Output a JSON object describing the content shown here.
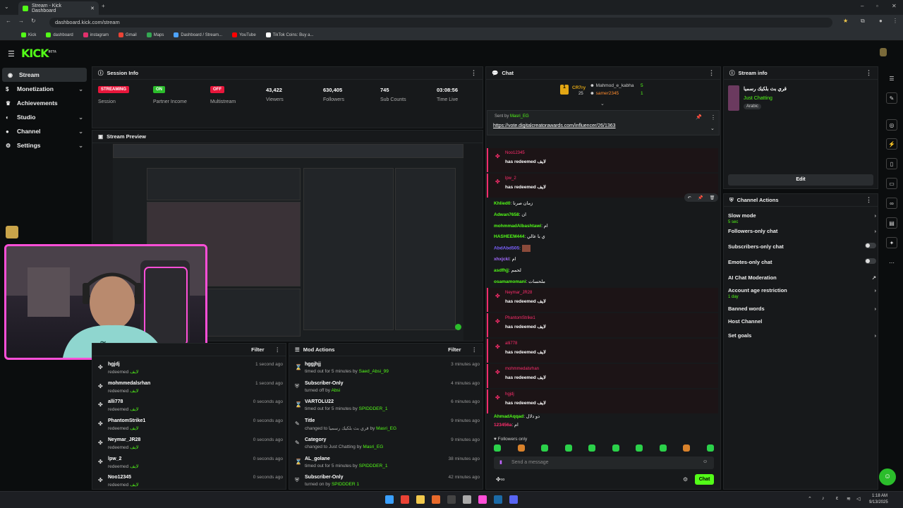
{
  "browser": {
    "tab_title": "Stream - Kick Dashboard",
    "url": "dashboard.kick.com/stream",
    "bookmarks": [
      "Kick",
      "dashboard",
      "instagram",
      "Gmail",
      "Maps",
      "Dashboard / Stream...",
      "YouTube",
      "TikTok Coins: Buy a..."
    ]
  },
  "app": {
    "logo": "KICK",
    "logo_tag": "BETA"
  },
  "nav": {
    "items": [
      {
        "label": "Stream",
        "icon": "broadcast-icon",
        "expandable": false
      },
      {
        "label": "Monetization",
        "icon": "dollar-icon",
        "expandable": true
      },
      {
        "label": "Achievements",
        "icon": "trophy-icon",
        "expandable": false
      },
      {
        "label": "Studio",
        "icon": "studio-icon",
        "expandable": true
      },
      {
        "label": "Channel",
        "icon": "person-icon",
        "expandable": true
      },
      {
        "label": "Settings",
        "icon": "gear-icon",
        "expandable": true
      }
    ]
  },
  "session": {
    "title": "Session Info",
    "items": [
      {
        "badge": "STREAMING",
        "badge_color": "#e8163b",
        "label": "Session"
      },
      {
        "badge": "ON",
        "badge_color": "#2bbd2b",
        "label": "Partner Income"
      },
      {
        "badge": "OFF",
        "badge_color": "#e8163b",
        "label": "Multistream"
      },
      {
        "value": "43,422",
        "label": "Viewers"
      },
      {
        "value": "630,405",
        "label": "Followers"
      },
      {
        "value": "745",
        "label": "Sub Counts"
      },
      {
        "value": "03:08:56",
        "label": "Time Live"
      }
    ]
  },
  "preview": {
    "title": "Stream Preview"
  },
  "redemptions": {
    "filter": "Filter",
    "rows": [
      {
        "user": "hgjdj",
        "action": "redeemed",
        "reward": "لايف",
        "time": "1 second ago"
      },
      {
        "user": "mohmmedalsrhan",
        "action": "redeemed",
        "reward": "لايف",
        "time": "1 second ago"
      },
      {
        "user": "alli778",
        "action": "redeemed",
        "reward": "لايف",
        "time": "0 seconds ago"
      },
      {
        "user": "PhantomStrike1",
        "action": "redeemed",
        "reward": "لايف",
        "time": "0 seconds ago"
      },
      {
        "user": "Neymar_JR28",
        "action": "redeemed",
        "reward": "لايف",
        "time": "0 seconds ago"
      },
      {
        "user": "lpw_2",
        "action": "redeemed",
        "reward": "لايف",
        "time": "0 seconds ago"
      },
      {
        "user": "Noo12345",
        "action": "redeemed",
        "reward": "لايف",
        "time": "0 seconds ago"
      }
    ]
  },
  "mod_actions": {
    "title": "Mod Actions",
    "filter": "Filter",
    "rows": [
      {
        "icon": "timeout-icon",
        "name": "hggjhjj",
        "detail": "timed out for 5 minutes by",
        "by": "Saed_Absi_99",
        "time": "3 minutes ago"
      },
      {
        "icon": "shield-icon",
        "name": "Subscriber-Only",
        "detail": "turned off by",
        "by": "Absi",
        "time": "4 minutes ago"
      },
      {
        "icon": "timeout-icon",
        "name": "VARTOLU22",
        "detail": "timed out for 5 minutes by",
        "by": "SPIDDDER_1",
        "time": "6 minutes ago"
      },
      {
        "icon": "edit-icon",
        "name": "Title",
        "detail": "changed to قري بث بلكيك رسميا by",
        "by": "Masri_EG",
        "time": "9 minutes ago"
      },
      {
        "icon": "edit-icon",
        "name": "Category",
        "detail": "changed to Just Chatting by",
        "by": "Masri_EG",
        "time": "9 minutes ago"
      },
      {
        "icon": "timeout-icon",
        "name": "AL_golane",
        "detail": "timed out for 5 minutes by",
        "by": "SPIDDDER_1",
        "time": "38 minutes ago"
      },
      {
        "icon": "shield-icon",
        "name": "Subscriber-Only",
        "detail": "turned on by",
        "by": "SPIDDDER 1",
        "time": "42 minutes ago"
      }
    ]
  },
  "chat": {
    "title": "Chat",
    "top_gifter": {
      "name": "CR7ry",
      "count": "25"
    },
    "top_users": [
      {
        "name": "Mahmod_e_kabha",
        "count": "5"
      },
      {
        "name": "samer2345",
        "count": "1"
      }
    ],
    "pinned": {
      "sent_by": "Sent by",
      "by_user": "Masri_EG",
      "link": "https://vote.digitalcreatorawards.com/influencer/26/1363"
    },
    "redeem_text": "has redeemed",
    "reward": "لايف",
    "redeems_top": [
      {
        "user": "Noo12345"
      },
      {
        "user": "lpw_2"
      }
    ],
    "messages": [
      {
        "user": "Khlied0",
        "color": "#53fc18",
        "text": "زمان صرنا"
      },
      {
        "user": "Adwan7658",
        "color": "#53fc18",
        "text": "ان"
      },
      {
        "user": "mohmmadAlbashtawi",
        "color": "#53fc18",
        "text": "ام"
      },
      {
        "user": "HASHEEM444",
        "color": "#53fc18",
        "text": "ي با عالي"
      },
      {
        "user": "AbdAbd505",
        "color": "#7b61ff",
        "text": ""
      },
      {
        "user": "xhxjckl",
        "color": "#a46bff",
        "text": "ام"
      },
      {
        "user": "asdfhjj",
        "color": "#53fc18",
        "text": "لحمم"
      },
      {
        "user": "osamamomani",
        "color": "#53fc18",
        "text": "ملحسات"
      }
    ],
    "redeems_bottom": [
      {
        "user": "Neymar_JR28"
      },
      {
        "user": "PhantomStrike1"
      },
      {
        "user": "alli778"
      },
      {
        "user": "mohmmedalsrhan"
      },
      {
        "user": "hgjdj"
      }
    ],
    "tail_messages": [
      {
        "user": "AhmadAqqad",
        "color": "#53fc18",
        "text": "دو دلال"
      },
      {
        "user": "123456a",
        "color": "#ff2d6d",
        "text": "ام"
      }
    ],
    "followers_only": "Followers only",
    "input_placeholder": "Send a message",
    "send_label": "Chat"
  },
  "stream_info": {
    "title": "Stream info",
    "stream_title": "قري بث بلكيك رسميا",
    "category": "Just Chatting",
    "language": "Arabic",
    "edit_label": "Edit"
  },
  "channel_actions": {
    "title": "Channel Actions",
    "items": [
      {
        "label": "Slow mode",
        "sub": "5 sec",
        "control": "arrow"
      },
      {
        "label": "Followers-only chat",
        "sub": "",
        "control": "arrow"
      },
      {
        "label": "Subscribers-only chat",
        "sub": "",
        "control": "toggle"
      },
      {
        "label": "Emotes-only chat",
        "sub": "",
        "control": "toggle"
      },
      {
        "label": "AI Chat Moderation",
        "sub": "",
        "control": "external"
      },
      {
        "label": "Account age restriction",
        "sub": "1 day",
        "control": "arrow"
      },
      {
        "label": "Banned words",
        "sub": "",
        "control": "arrow"
      },
      {
        "label": "Host Channel",
        "sub": "",
        "control": "none"
      },
      {
        "label": "Set goals",
        "sub": "",
        "control": "arrow"
      }
    ]
  },
  "taskbar": {
    "time": "1:18 AM",
    "date": "9/13/2025"
  }
}
